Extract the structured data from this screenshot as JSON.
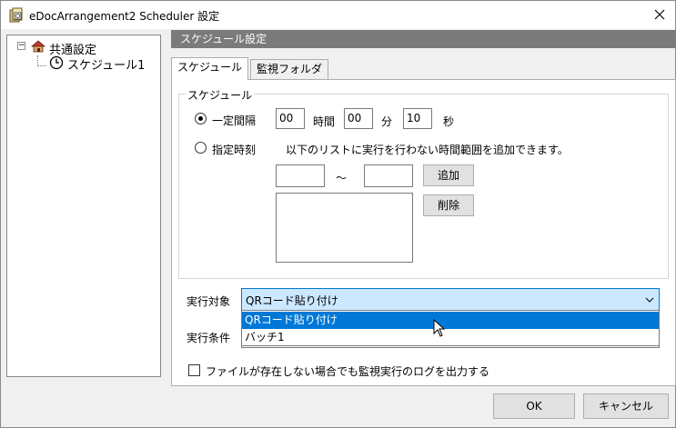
{
  "window": {
    "title": "eDocArrangement2 Scheduler 設定"
  },
  "tree": {
    "toggle_symbol": "⊟",
    "root_label": "共通設定",
    "child_label": "スケジュール1"
  },
  "section_header": "スケジュール設定",
  "tabs": [
    {
      "label": "スケジュール",
      "active": true
    },
    {
      "label": "監視フォルダ",
      "active": false
    }
  ],
  "schedule_group": {
    "legend": "スケジュール",
    "interval": {
      "radio_label": "一定間隔",
      "selected": true,
      "hours_value": "00",
      "hours_unit": "時間",
      "minutes_value": "00",
      "minutes_unit": "分",
      "seconds_value": "10",
      "seconds_unit": "秒"
    },
    "specific_time": {
      "radio_label": "指定時刻",
      "selected": false,
      "hint": "以下のリストに実行を行わない時間範囲を追加できます。",
      "start_value": "",
      "tilde": "～",
      "end_value": "",
      "add_button": "追加",
      "delete_button": "削除",
      "ranges": []
    }
  },
  "exec_target": {
    "label": "実行対象",
    "selected_value": "QRコード貼り付け",
    "options": [
      "QRコード貼り付け",
      "バッチ1"
    ],
    "highlighted_index": 0
  },
  "exec_condition": {
    "label": "実行条件"
  },
  "log_checkbox": {
    "label": "ファイルが存在しない場合でも監視実行のログを出力する",
    "checked": false
  },
  "buttons": {
    "ok": "OK",
    "cancel": "キャンセル"
  },
  "colors": {
    "accent": "#0078d7",
    "header_bg": "#7b7b7b",
    "combo_bg": "#cce8ff"
  }
}
